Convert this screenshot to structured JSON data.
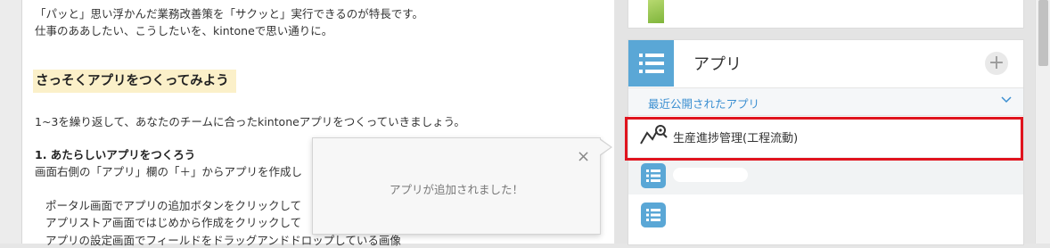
{
  "doc": {
    "intro_line1": "「パッと」思い浮かんだ業務改善策を「サクッと」実行できるのが特長です。",
    "intro_line2": "仕事のああしたい、こうしたいを、kintoneで思い通りに。",
    "section_heading": "さっそくアプリをつくってみよう",
    "repeat_text": "1~3を繰り返して、あなたのチームに合ったkintoneアプリをつくっていきましょう。",
    "step1_title": "1. あたらしいアプリをつくろう",
    "step1_desc": "画面右側の「アプリ」欄の「＋」からアプリを作成し",
    "bullet1": "ポータル画面でアプリの追加ボタンをクリックして",
    "bullet2": "アプリストア画面ではじめから作成をクリックして",
    "bullet3": "アプリの設定画面でフィールドをドラッグアンドドロップしている画像"
  },
  "toast": {
    "message": "アプリが追加されました！",
    "close_symbol": "×"
  },
  "apps_panel": {
    "title": "アプリ",
    "add_symbol": "+",
    "recent_label": "最近公開されたアプリ",
    "items": [
      {
        "label": "生産進捗管理(工程流動)",
        "icon": "progress-chart-icon"
      },
      {
        "label": "",
        "icon": "list-icon"
      },
      {
        "label": "",
        "icon": "list-icon"
      }
    ]
  },
  "colors": {
    "accent_blue": "#5aa7d6",
    "link_blue": "#3b8fd1",
    "highlight_red": "#e0141e",
    "heading_bg": "#fbf0c9"
  }
}
